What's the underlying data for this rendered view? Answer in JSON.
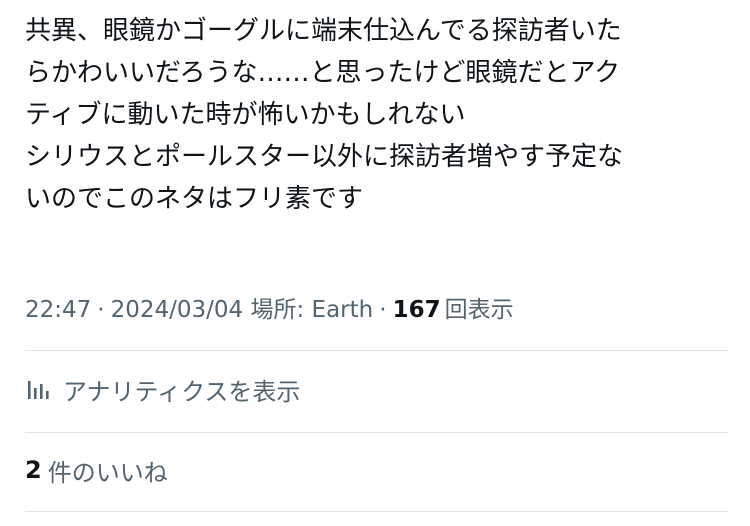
{
  "post": {
    "lines": [
      "共異、眼鏡かゴーグルに端末仕込んでる探訪者いた",
      "らかわいいだろうな……と思ったけど眼鏡だとアク",
      "ティブに動いた時が怖いかもしれない",
      "シリウスとポールスター以外に探訪者増やす予定な",
      "いのでこのネタはフリ素です"
    ]
  },
  "meta": {
    "time": "22:47",
    "separator": "·",
    "date": "2024/03/04",
    "location_label": "場所: Earth",
    "views_count": "167",
    "views_label": "回表示"
  },
  "analytics": {
    "icon": "bar-chart-icon",
    "label": "アナリティクスを表示"
  },
  "likes": {
    "count": "2",
    "label": "件のいいね"
  },
  "colors": {
    "text_primary": "#0f1419",
    "text_secondary": "#536471",
    "divider": "#dfe3e6"
  }
}
